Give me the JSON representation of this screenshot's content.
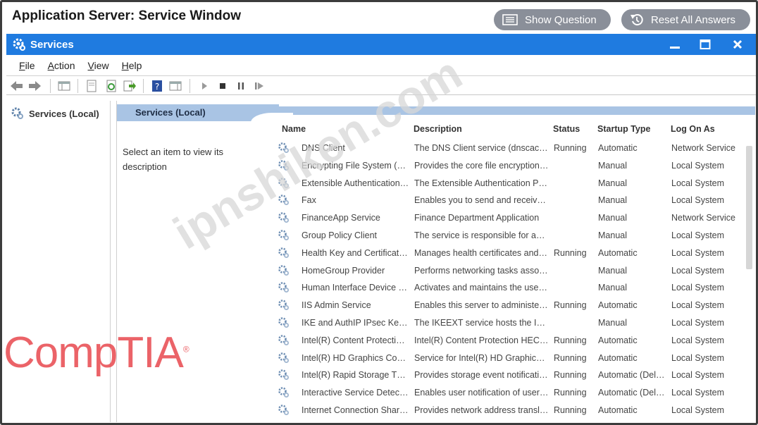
{
  "header": {
    "title": "Application Server: Service Window",
    "show_question_label": "Show Question",
    "reset_label": "Reset All Answers"
  },
  "window": {
    "title": "Services",
    "accent": "#1f7be0"
  },
  "menu": {
    "items": [
      "File",
      "Action",
      "View",
      "Help"
    ]
  },
  "tree": {
    "root_label": "Services (Local)"
  },
  "pane": {
    "title": "Services (Local)",
    "hint": "Select an item to view its description"
  },
  "table": {
    "columns": [
      "Name",
      "Description",
      "Status",
      "Startup Type",
      "Log On As"
    ],
    "rows": [
      [
        "DNS Client",
        "The DNS Client service (dnscac…",
        "Running",
        "Automatic",
        "Network Service"
      ],
      [
        "Encrypting File System (…",
        "Provides the core file encryption…",
        "",
        "Manual",
        "Local System"
      ],
      [
        "Extensible Authentication…",
        "The Extensible Authentication P…",
        "",
        "Manual",
        "Local System"
      ],
      [
        "Fax",
        "Enables you to send and receiv…",
        "",
        "Manual",
        "Local System"
      ],
      [
        "FinanceApp Service",
        "Finance Department Application",
        "",
        "Manual",
        "Network Service"
      ],
      [
        "Group Policy Client",
        "The service is responsible for a…",
        "",
        "Manual",
        "Local System"
      ],
      [
        "Health Key and Certificat…",
        "Manages health certificates and…",
        "Running",
        "Automatic",
        "Local System"
      ],
      [
        "HomeGroup Provider",
        "Performs networking tasks asso…",
        "",
        "Manual",
        "Local System"
      ],
      [
        "Human Interface Device …",
        "Activates and maintains the use…",
        "",
        "Manual",
        "Local System"
      ],
      [
        "IIS Admin Service",
        "Enables this server to administe…",
        "Running",
        "Automatic",
        "Local System"
      ],
      [
        "IKE and AuthIP IPsec Ke…",
        "The IKEEXT service hosts the I…",
        "",
        "Manual",
        "Local System"
      ],
      [
        "Intel(R) Content Protecti…",
        "Intel(R) Content Protection HEC…",
        "Running",
        "Automatic",
        "Local System"
      ],
      [
        "Intel(R) HD Graphics Co…",
        "Service for Intel(R) HD Graphic…",
        "Running",
        "Automatic",
        "Local System"
      ],
      [
        "Intel(R) Rapid Storage T…",
        "Provides storage event notificati…",
        "Running",
        "Automatic (Del…",
        "Local System"
      ],
      [
        "Interactive Service Detec…",
        "Enables user notification of user…",
        "Running",
        "Automatic (Del…",
        "Local System"
      ],
      [
        "Internet Connection Shar…",
        "Provides network address transl…",
        "Running",
        "Automatic",
        "Local System"
      ]
    ]
  },
  "watermark": {
    "logo_text": "CompTIA",
    "logo_mark": "®",
    "site_text": "ipnshiken.com"
  }
}
